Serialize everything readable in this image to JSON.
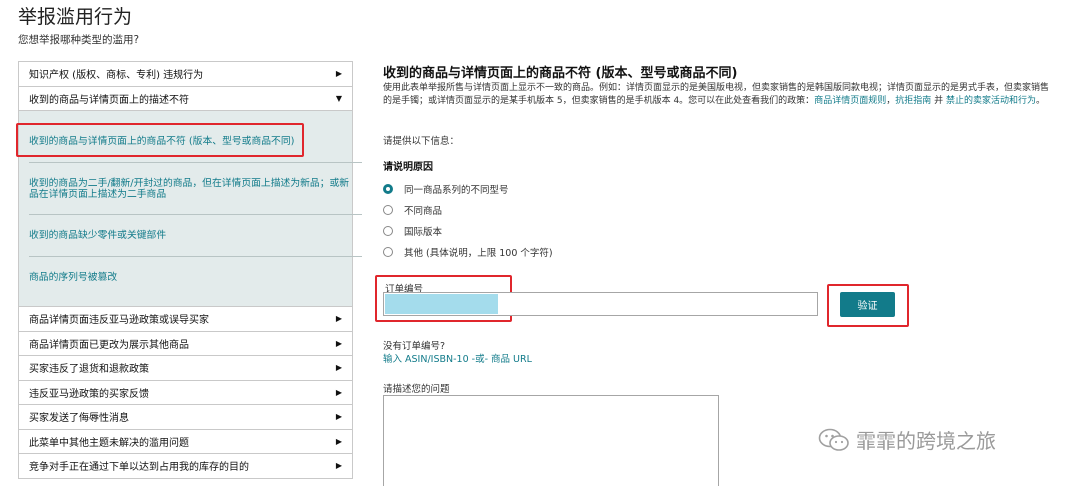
{
  "page": {
    "title": "举报滥用行为",
    "subtitle": "您想举报哪种类型的滥用?"
  },
  "left_menu": {
    "top_items": [
      {
        "label": "知识产权 (版权、商标、专利) 违规行为"
      },
      {
        "label": "收到的商品与详情页面上的描述不符"
      }
    ],
    "sub_items": [
      {
        "label": "收到的商品与详情页面上的商品不符 (版本、型号或商品不同)"
      },
      {
        "label": "收到的商品为二手/翻新/开封过的商品，但在详情页面上描述为新品；或新品在详情页面上描述为二手商品"
      },
      {
        "label": "收到的商品缺少零件或关键部件"
      },
      {
        "label": "商品的序列号被篡改"
      }
    ],
    "bottom_items": [
      {
        "label": "商品详情页面违反亚马逊政策或误导买家"
      },
      {
        "label": "商品详情页面已更改为展示其他商品"
      },
      {
        "label": "买家违反了退货和退款政策"
      },
      {
        "label": "违反亚马逊政策的买家反馈"
      },
      {
        "label": "买家发送了侮辱性消息"
      },
      {
        "label": "此菜单中其他主题未解决的滥用问题"
      },
      {
        "label": "竞争对手正在通过下单以达到占用我的库存的目的"
      }
    ],
    "arrow_right": "▶",
    "arrow_down": "▼"
  },
  "form": {
    "title": "收到的商品与详情页面上的商品不符 (版本、型号或商品不同)",
    "desc_text": "使用此表单举报所售与详情页面上显示不一致的商品。例如：详情页面显示的是美国版电视，但卖家销售的是韩国版同款电视；详情页面显示的是男式手表，但卖家销售的是手镯；或详情页面显示的是某手机版本 5，但卖家销售的是手机版本 4。您可以在此处查看我们的政策：",
    "desc_link1": "商品详情页面规则",
    "desc_sep1": "，",
    "desc_link2": "抗拒指南",
    "desc_sep2": " 并 ",
    "desc_link3": "禁止的卖家活动和行为",
    "desc_end": "。",
    "provide_info": "请提供以下信息：",
    "reason_label": "请说明原因",
    "reasons": [
      {
        "label": "同一商品系列的不同型号",
        "checked": true
      },
      {
        "label": "不同商品",
        "checked": false
      },
      {
        "label": "国际版本",
        "checked": false
      },
      {
        "label": "其他 (具体说明，上限 100 个字符)",
        "checked": false
      }
    ],
    "order_label": "订单编号",
    "order_value": "",
    "verify_label": "验证",
    "no_order": "没有订单编号?",
    "asin_link": "输入 ASIN/ISBN-10 -或- 商品 URL",
    "describe_label": "请描述您的问题"
  },
  "watermark": {
    "text": "霏霏的跨境之旅",
    "icon": "wechat-icon"
  },
  "colors": {
    "link": "#127b8a",
    "button": "#127b8a",
    "subpanel": "#e3ebeb",
    "highlight": "#e0262c"
  }
}
